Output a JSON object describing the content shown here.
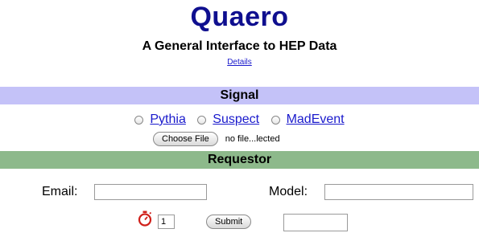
{
  "header": {
    "title": "Quaero",
    "subtitle": "A General Interface to HEP Data",
    "details_link": "Details"
  },
  "signal": {
    "heading": "Signal",
    "options": [
      {
        "label": "Pythia",
        "selected": false
      },
      {
        "label": "Suspect",
        "selected": false
      },
      {
        "label": "MadEvent",
        "selected": false
      }
    ],
    "choose_file_label": "Choose File",
    "file_status": "no file...lected"
  },
  "requestor": {
    "heading": "Requestor",
    "email_label": "Email:",
    "email_value": "",
    "model_label": "Model:",
    "model_value": ""
  },
  "submit_row": {
    "timer_icon": "stopwatch-icon",
    "count_value": "1",
    "submit_label": "Submit",
    "extra_value": ""
  },
  "colors": {
    "title": "#0f0f8f",
    "signal_band": "#c4c2f8",
    "requestor_band": "#8db98b",
    "link": "#1a1acc",
    "timer": "#d0201a"
  }
}
